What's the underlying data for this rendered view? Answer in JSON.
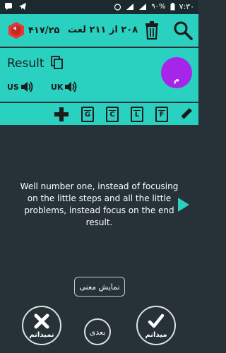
{
  "status": {
    "battery_percent": "۹۰%",
    "time": "۷:۳۰"
  },
  "header": {
    "score": "۴۱۷/۲۵",
    "word_count": "۲۰۸ از ۲۱۱ لغت"
  },
  "result": {
    "title": "Result",
    "us_label": "US",
    "uk_label": "UK",
    "avatar_letter": "م"
  },
  "tools": {
    "letters": [
      "G",
      "C",
      "L",
      "F"
    ]
  },
  "main": {
    "sentence": "Well number one, instead of focusing on the little steps and all the little problems, instead focus on the end result."
  },
  "actions": {
    "show_meaning": "نمایش معنی",
    "dont_know": "نمیدانم",
    "next": "بعدی",
    "know": "میدانم"
  },
  "colors": {
    "accent": "#2ad0c0",
    "background": "#263238",
    "avatar": "#a625e8",
    "ruby": "#e53935"
  }
}
